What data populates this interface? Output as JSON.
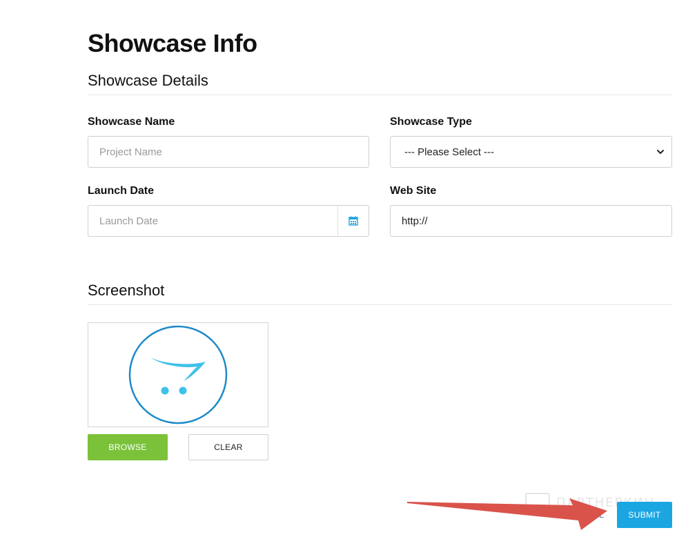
{
  "page": {
    "title": "Showcase Info"
  },
  "details": {
    "section_title": "Showcase Details",
    "showcase_name": {
      "label": "Showcase Name",
      "placeholder": "Project Name",
      "value": ""
    },
    "showcase_type": {
      "label": "Showcase Type",
      "selected": "--- Please Select ---"
    },
    "launch_date": {
      "label": "Launch Date",
      "placeholder": "Launch Date",
      "value": ""
    },
    "web_site": {
      "label": "Web Site",
      "value": "http://"
    }
  },
  "screenshot": {
    "section_title": "Screenshot",
    "image_icon": "opencart-cart-logo",
    "browse_label": "BROWSE",
    "clear_label": "CLEAR"
  },
  "actions": {
    "cancel_label": "CANCEL",
    "submit_label": "SUBMIT"
  },
  "overlay": {
    "watermark_text": "ПАРТНЕРКИН",
    "arrow_icon": "red-pointer-arrow"
  },
  "colors": {
    "browse": "#7bc23a",
    "submit": "#1ba6e2",
    "cancel_text": "#3a78b7",
    "logo_ring": "#1e8ac8",
    "logo_cart": "#3ec1ea",
    "arrow": "#d9534a"
  }
}
